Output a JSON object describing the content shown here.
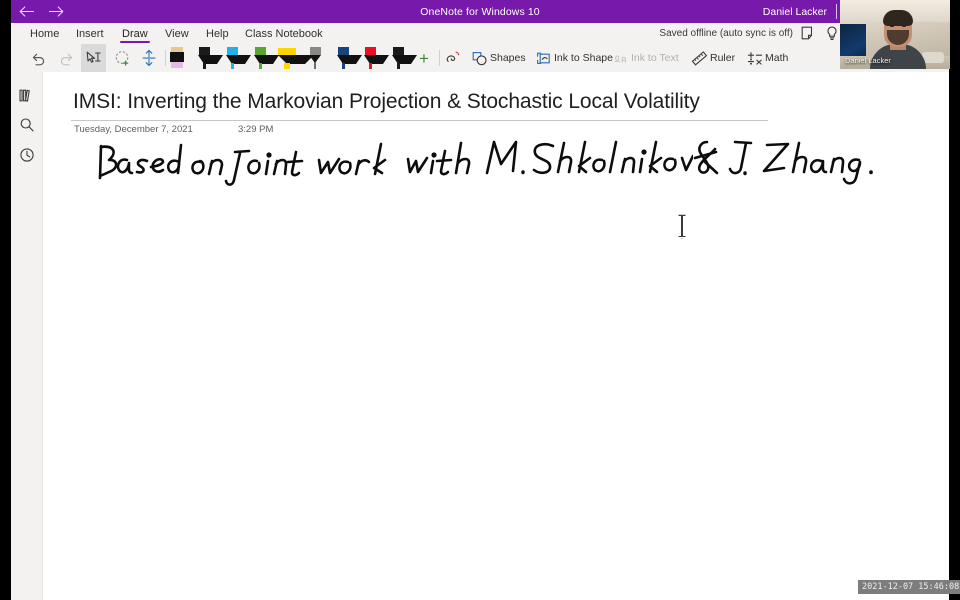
{
  "app": {
    "title": "OneNote for Windows 10",
    "account_name": "Daniel Lacker",
    "back_icon": "back-arrow-icon",
    "forward_icon": "forward-arrow-icon",
    "accent_color": "#7719aa"
  },
  "ribbon": {
    "tabs": [
      {
        "label": "Home",
        "active": false
      },
      {
        "label": "Insert",
        "active": false
      },
      {
        "label": "Draw",
        "active": true
      },
      {
        "label": "View",
        "active": false
      },
      {
        "label": "Help",
        "active": false
      },
      {
        "label": "Class Notebook",
        "active": false
      }
    ],
    "status": {
      "sync_text": "Saved offline (auto sync is off)",
      "icons": [
        "notes-icon",
        "lightbulb-icon",
        "bell-icon"
      ]
    }
  },
  "toolbar": {
    "undo_label": "Undo",
    "redo_label": "Redo",
    "buttons": [
      {
        "name": "undo-button",
        "icon": "undo-icon",
        "state": "enabled"
      },
      {
        "name": "redo-button",
        "icon": "redo-icon",
        "state": "disabled"
      },
      {
        "name": "select-ink-button",
        "icon": "lasso-text-select-icon",
        "state": "selected"
      },
      {
        "name": "lasso-select-button",
        "icon": "lasso-add-icon",
        "state": "enabled"
      },
      {
        "name": "insert-space-button",
        "icon": "insert-space-icon",
        "state": "enabled"
      }
    ],
    "pens": [
      {
        "name": "pen-eraser-tan",
        "type": "block",
        "cap": "#e7c98f",
        "tip": "#e4b9e4"
      },
      {
        "name": "pen-black-thin",
        "type": "pen",
        "color": "#1b1b1b"
      },
      {
        "name": "pen-cyan",
        "type": "pen",
        "color": "#22b0e8"
      },
      {
        "name": "pen-green",
        "type": "pen",
        "color": "#5aa52b"
      },
      {
        "name": "highlighter-yellow",
        "type": "chisel",
        "color": "#ffd500"
      },
      {
        "name": "pencil-grey",
        "type": "pencil",
        "color": "#8a8886"
      },
      {
        "name": "pen-blue",
        "type": "pen",
        "color": "#17457e"
      },
      {
        "name": "pen-red",
        "type": "pen",
        "color": "#e81123"
      },
      {
        "name": "pen-black",
        "type": "pen",
        "color": "#1b1b1b"
      }
    ],
    "add_pen_label": "+",
    "tools": [
      {
        "name": "eraser-tool",
        "icon": "eraser-icon",
        "label": "",
        "disabled": false
      },
      {
        "name": "shapes-tool",
        "icon": "shapes-icon",
        "label": "Shapes",
        "disabled": false
      },
      {
        "name": "ink-to-shape-tool",
        "icon": "ink-to-shape-icon",
        "label": "Ink to Shape",
        "disabled": false
      },
      {
        "name": "ink-to-text-tool",
        "icon": "ink-to-text-icon",
        "label": "Ink to Text",
        "disabled": true
      },
      {
        "name": "ruler-tool",
        "icon": "ruler-icon",
        "label": "Ruler",
        "disabled": false
      },
      {
        "name": "math-tool",
        "icon": "math-icon",
        "label": "Math",
        "disabled": false
      }
    ]
  },
  "rail": {
    "items": [
      {
        "name": "show-notebooks-button",
        "icon": "notebooks-icon"
      },
      {
        "name": "search-button",
        "icon": "search-icon"
      },
      {
        "name": "recent-notes-button",
        "icon": "clock-icon"
      }
    ]
  },
  "page": {
    "title": "IMSI: Inverting the Markovian Projection & Stochastic Local Volatility",
    "date": "Tuesday, December 7, 2021",
    "time": "3:29 PM",
    "ink_text": "Based on joint work with M. Shkolnikov & J. Zhang.",
    "cursor": "text-i-beam-cursor"
  },
  "webcam": {
    "participant_name": "Daniel Lacker"
  },
  "recording": {
    "timestamp": "2021-12-07 15:46:08"
  }
}
